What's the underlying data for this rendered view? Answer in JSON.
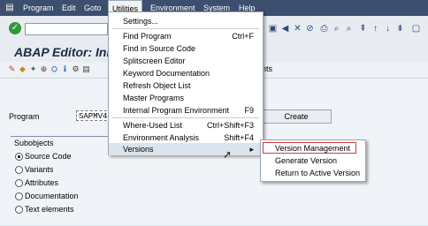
{
  "menubar": {
    "items": [
      "Program",
      "Edit",
      "Goto",
      "Utilities",
      "Environment",
      "System",
      "Help"
    ],
    "active_index": 3
  },
  "title": "ABAP Editor: Init",
  "app_toolbar": {
    "right_label": "nts"
  },
  "program": {
    "label": "Program",
    "value": "SAPMV4",
    "create_label": "Create"
  },
  "subobjects": {
    "title": "Subobjects",
    "items": [
      {
        "label": "Source Code",
        "checked": true
      },
      {
        "label": "Variants",
        "checked": false
      },
      {
        "label": "Attributes",
        "checked": false
      },
      {
        "label": "Documentation",
        "checked": false
      },
      {
        "label": "Text elements",
        "checked": false
      }
    ]
  },
  "utilities_menu": {
    "items": [
      {
        "label": "Settings...",
        "shortcut": ""
      },
      {
        "label": "Find Program",
        "shortcut": "Ctrl+F"
      },
      {
        "label": "Find in Source Code",
        "shortcut": ""
      },
      {
        "label": "Splitscreen Editor",
        "shortcut": ""
      },
      {
        "label": "Keyword Documentation",
        "shortcut": ""
      },
      {
        "label": "Refresh Object List",
        "shortcut": ""
      },
      {
        "label": "Master Programs",
        "shortcut": ""
      },
      {
        "label": "Internal Program Environment",
        "shortcut": "F9"
      },
      {
        "label": "Where-Used List",
        "shortcut": "Ctrl+Shift+F3"
      },
      {
        "label": "Environment Analysis",
        "shortcut": "Shift+F4"
      },
      {
        "label": "Versions",
        "shortcut": ""
      }
    ]
  },
  "versions_submenu": {
    "items": [
      "Version Management",
      "Generate Version",
      "Return to Active Version"
    ]
  },
  "colors": {
    "menubar_bg": "#3c4f6e",
    "highlight_border": "#d23a3a",
    "title_color": "#1b2a44"
  }
}
